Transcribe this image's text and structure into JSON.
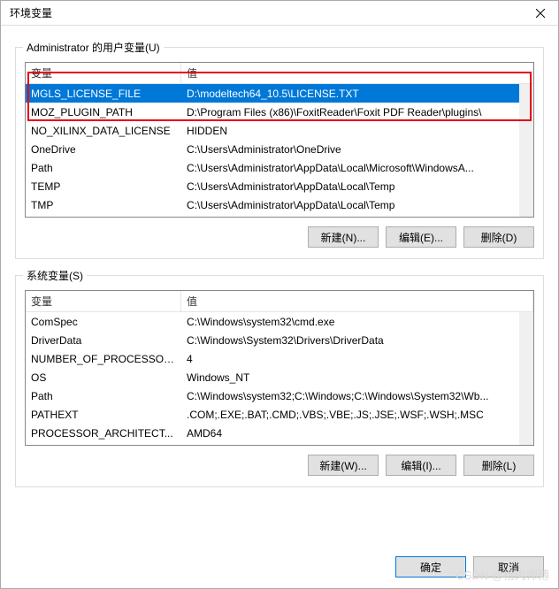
{
  "window": {
    "title": "环境变量"
  },
  "userGroup": {
    "legend": "Administrator 的用户变量(U)",
    "headers": {
      "name": "变量",
      "value": "值"
    },
    "rows": [
      {
        "name": "MGLS_LICENSE_FILE",
        "value": "D:\\modeltech64_10.5\\LICENSE.TXT",
        "selected": true
      },
      {
        "name": "MOZ_PLUGIN_PATH",
        "value": "D:\\Program Files (x86)\\FoxitReader\\Foxit PDF Reader\\plugins\\"
      },
      {
        "name": "NO_XILINX_DATA_LICENSE",
        "value": "HIDDEN"
      },
      {
        "name": "OneDrive",
        "value": "C:\\Users\\Administrator\\OneDrive"
      },
      {
        "name": "Path",
        "value": "C:\\Users\\Administrator\\AppData\\Local\\Microsoft\\WindowsA..."
      },
      {
        "name": "TEMP",
        "value": "C:\\Users\\Administrator\\AppData\\Local\\Temp"
      },
      {
        "name": "TMP",
        "value": "C:\\Users\\Administrator\\AppData\\Local\\Temp"
      }
    ],
    "buttons": {
      "new": "新建(N)...",
      "edit": "编辑(E)...",
      "delete": "删除(D)"
    }
  },
  "sysGroup": {
    "legend": "系统变量(S)",
    "headers": {
      "name": "变量",
      "value": "值"
    },
    "rows": [
      {
        "name": "ComSpec",
        "value": "C:\\Windows\\system32\\cmd.exe"
      },
      {
        "name": "DriverData",
        "value": "C:\\Windows\\System32\\Drivers\\DriverData"
      },
      {
        "name": "NUMBER_OF_PROCESSORS",
        "value": "4"
      },
      {
        "name": "OS",
        "value": "Windows_NT"
      },
      {
        "name": "Path",
        "value": "C:\\Windows\\system32;C:\\Windows;C:\\Windows\\System32\\Wb..."
      },
      {
        "name": "PATHEXT",
        "value": ".COM;.EXE;.BAT;.CMD;.VBS;.VBE;.JS;.JSE;.WSF;.WSH;.MSC"
      },
      {
        "name": "PROCESSOR_ARCHITECT...",
        "value": "AMD64"
      }
    ],
    "buttons": {
      "new": "新建(W)...",
      "edit": "编辑(I)...",
      "delete": "删除(L)"
    }
  },
  "footer": {
    "ok": "确定",
    "cancel": "取消"
  },
  "watermark": "CSDN @杨肉师傅"
}
